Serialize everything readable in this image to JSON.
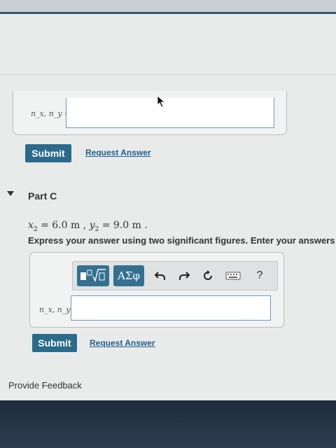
{
  "part_b": {
    "answer_label": "n_x, n_y =",
    "submit_label": "Submit",
    "request_label": "Request Answer"
  },
  "part_c": {
    "title": "Part C",
    "given": {
      "x_sym": "x",
      "x_sub": "2",
      "x_val": " = 6.0 m , ",
      "y_sym": "y",
      "y_sub": "2",
      "y_val": " = 9.0 m ."
    },
    "instruction": "Express your answer using two significant figures. Enter your answers num",
    "toolbar": {
      "templates_icon": "templates-sqrt-icon",
      "greek_label": "ΑΣφ",
      "undo_icon": "undo-icon",
      "redo_icon": "redo-icon",
      "reset_icon": "reset-icon",
      "keyboard_icon": "keyboard-icon",
      "help_label": "?"
    },
    "answer_label": "n_x, n_y =",
    "submit_label": "Submit",
    "request_label": "Request Answer"
  },
  "footer": {
    "feedback_label": "Provide Feedback"
  },
  "colors": {
    "accent": "#2b6a8a",
    "link": "#1f5f8f",
    "toolbar_button": "#34708f"
  }
}
